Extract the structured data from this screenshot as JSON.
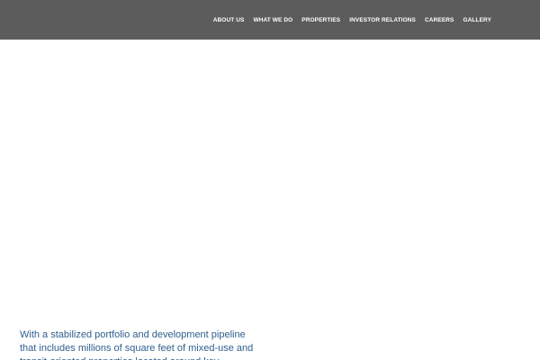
{
  "navigation": {
    "items": [
      {
        "label": "ABOUT US"
      },
      {
        "label": "WHAT WE DO"
      },
      {
        "label": "PROPERTIES"
      },
      {
        "label": "INVESTOR RELATIONS"
      },
      {
        "label": "CAREERS"
      },
      {
        "label": "GALLERY"
      }
    ]
  },
  "content": {
    "intro": "With a stabilized portfolio and development pipeline that includes millions of square feet of mixed-use and transit-oriented properties located around key"
  },
  "colors": {
    "nav_background": "#5c5c5c",
    "nav_text": "#ffffff",
    "page_background": "#ffffff",
    "intro_text": "#2f5f8e"
  }
}
